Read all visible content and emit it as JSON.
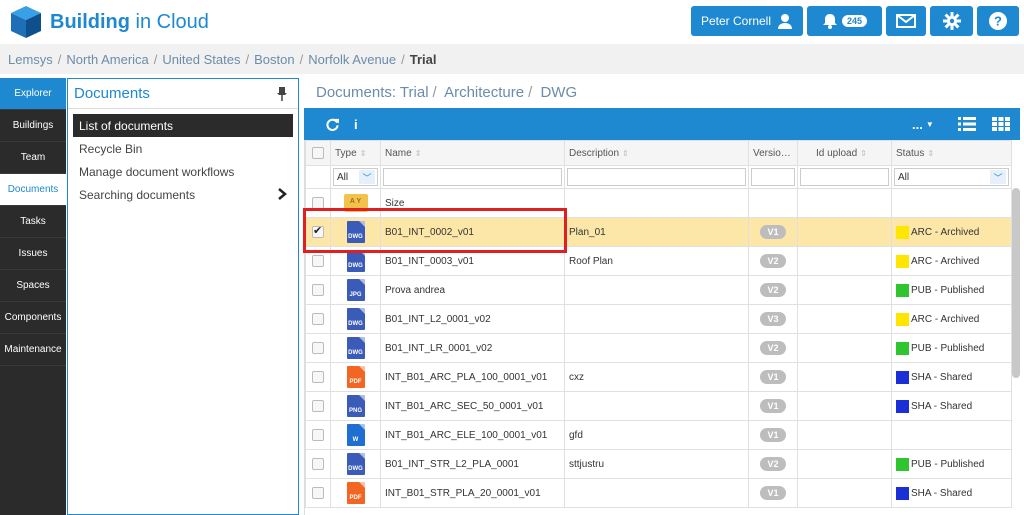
{
  "app": {
    "logo_strong": "Building",
    "logo_thin": " in Cloud",
    "user_name": "Peter Cornell",
    "notifications": "245"
  },
  "breadcrumb": [
    "Lemsys",
    "North America",
    "United States",
    "Boston",
    "Norfolk Avenue",
    "Trial"
  ],
  "sidebar": {
    "items": [
      {
        "label": "Explorer"
      },
      {
        "label": "Buildings"
      },
      {
        "label": "Team"
      },
      {
        "label": "Documents"
      },
      {
        "label": "Tasks"
      },
      {
        "label": "Issues"
      },
      {
        "label": "Spaces"
      },
      {
        "label": "Components"
      },
      {
        "label": "Maintenance"
      }
    ]
  },
  "docpanel": {
    "title": "Documents",
    "items": [
      {
        "label": "List of documents"
      },
      {
        "label": "Recycle Bin"
      },
      {
        "label": "Manage document workflows"
      },
      {
        "label": "Searching documents"
      }
    ]
  },
  "main": {
    "path": [
      "Documents: Trial",
      "Architecture",
      "DWG"
    ],
    "toolbar_more": "...",
    "info_label": "i"
  },
  "table": {
    "headers": {
      "type": "Type",
      "name": "Name",
      "description": "Description",
      "version": "Version",
      "id_upload": "Id upload",
      "status": "Status"
    },
    "filter_type": "All",
    "filter_status": "All",
    "folder_label": "A Y",
    "rows": [
      {
        "kind": "folder",
        "name": "Size",
        "description": "",
        "version": "",
        "status": "",
        "status_color": ""
      },
      {
        "kind": "DWG",
        "color": "#3b5bb8",
        "name": "B01_INT_0002_v01",
        "description": "Plan_01",
        "version": "V1",
        "status": "ARC - Archived",
        "status_color": "#ffe600",
        "checked": true
      },
      {
        "kind": "DWG",
        "color": "#3b5bb8",
        "name": "B01_INT_0003_v01",
        "description": "Roof Plan",
        "version": "V2",
        "status": "ARC - Archived",
        "status_color": "#ffe600"
      },
      {
        "kind": "JPG",
        "color": "#3b5bb8",
        "name": "Prova andrea",
        "description": "",
        "version": "V2",
        "status": "PUB - Published",
        "status_color": "#2ec52e"
      },
      {
        "kind": "DWG",
        "color": "#3b5bb8",
        "name": "B01_INT_L2_0001_v02",
        "description": "",
        "version": "V3",
        "status": "ARC - Archived",
        "status_color": "#ffe600"
      },
      {
        "kind": "DWG",
        "color": "#3b5bb8",
        "name": "B01_INT_LR_0001_v02",
        "description": "",
        "version": "V2",
        "status": "PUB - Published",
        "status_color": "#2ec52e"
      },
      {
        "kind": "PDF",
        "color": "#f26522",
        "name": "INT_B01_ARC_PLA_100_0001_v01",
        "description": "cxz",
        "version": "V1",
        "status": "SHA - Shared",
        "status_color": "#1a2fd6"
      },
      {
        "kind": "PNG",
        "color": "#3b5bb8",
        "name": "INT_B01_ARC_SEC_50_0001_v01",
        "description": "",
        "version": "V1",
        "status": "SHA - Shared",
        "status_color": "#1a2fd6"
      },
      {
        "kind": "W",
        "color": "#1e6fd1",
        "name": "INT_B01_ARC_ELE_100_0001_v01",
        "description": "gfd",
        "version": "V1",
        "status": "",
        "status_color": ""
      },
      {
        "kind": "DWG",
        "color": "#3b5bb8",
        "name": "B01_INT_STR_L2_PLA_0001",
        "description": "sttjustru",
        "version": "V2",
        "status": "PUB - Published",
        "status_color": "#2ec52e"
      },
      {
        "kind": "PDF",
        "color": "#f26522",
        "name": "INT_B01_STR_PLA_20_0001_v01",
        "description": "",
        "version": "V1",
        "status": "SHA - Shared",
        "status_color": "#1a2fd6"
      }
    ]
  }
}
